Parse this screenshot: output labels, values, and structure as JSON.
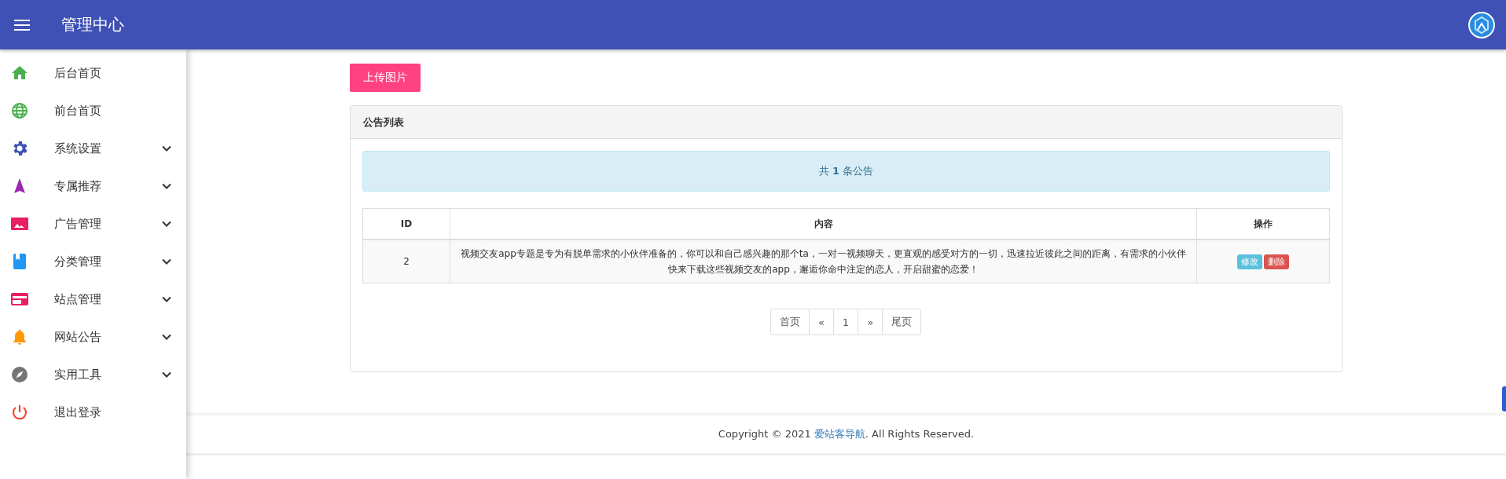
{
  "header": {
    "title": "管理中心"
  },
  "sidebar": {
    "items": [
      {
        "label": "后台首页",
        "color": "#4caf50",
        "kind": "link"
      },
      {
        "label": "前台首页",
        "color": "#4caf50",
        "kind": "link"
      },
      {
        "label": "系统设置",
        "color": "#3f51b5",
        "kind": "group"
      },
      {
        "label": "专属推荐",
        "color": "#9c27b0",
        "kind": "group"
      },
      {
        "label": "广告管理",
        "color": "#e91e63",
        "kind": "group"
      },
      {
        "label": "分类管理",
        "color": "#2196f3",
        "kind": "group"
      },
      {
        "label": "站点管理",
        "color": "#e91e63",
        "kind": "group"
      },
      {
        "label": "网站公告",
        "color": "#ff9800",
        "kind": "group"
      },
      {
        "label": "实用工具",
        "color": "#757575",
        "kind": "group"
      },
      {
        "label": "退出登录",
        "color": "#f44336",
        "kind": "link"
      }
    ]
  },
  "upload_button": "上传图片",
  "panel": {
    "title": "公告列表",
    "alert": "共 **1** 条公告",
    "table": {
      "columns": [
        "ID",
        "内容",
        "操作"
      ],
      "rows": [
        {
          "id": "2",
          "content": "视频交友app专题是专为有脱单需求的小伙伴准备的，你可以和自己感兴趣的那个ta，一对一视频聊天，更直观的感受对方的一切，迅速拉近彼此之间的距离，有需求的小伙伴快来下载这些视频交友的app，邂逅你命中注定的恋人，开启甜蜜的恋爱！",
          "actions": [
            {
              "label": "修改",
              "kind": "edit"
            },
            {
              "label": "删除",
              "kind": "delete"
            }
          ]
        }
      ]
    },
    "pagination": [
      {
        "label": "首页",
        "selected": false
      },
      {
        "label": "«",
        "selected": false
      },
      {
        "label": "1",
        "selected": false
      },
      {
        "label": "»",
        "selected": false
      },
      {
        "label": "尾页",
        "selected": false
      }
    ]
  },
  "footer": {
    "before": "Copyright © 2021 ",
    "link": "爱站客导航",
    "after": ". All Rights Reserved."
  }
}
